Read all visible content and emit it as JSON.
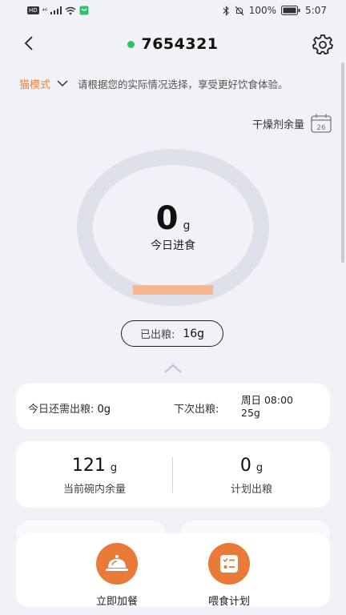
{
  "status_bar": {
    "network_badge": "HD",
    "signal_label": "⁴⁶",
    "battery_percent": "100%",
    "time": "5:07"
  },
  "header": {
    "device_id": "7654321",
    "online_color": "#2ec26a"
  },
  "mode": {
    "label": "猫模式",
    "hint": "请根据您的实际情况选择，享受更好饮食体验。"
  },
  "desiccant": {
    "label": "干燥剂余量",
    "calendar_day": "26"
  },
  "today": {
    "food_value": "0",
    "food_unit": "g",
    "food_label": "今日进食",
    "ring_fill_fraction": 0.06
  },
  "dispensed": {
    "label": "已出粮:",
    "value": "16g"
  },
  "schedule": {
    "remaining_label": "今日还需出粮:",
    "remaining_value": "0g",
    "next_label": "下次出粮:",
    "next_time": "周日 08:00",
    "next_amount": "25g"
  },
  "stats": {
    "bowl_value": "121",
    "bowl_unit": "g",
    "bowl_label": "当前碗内余量",
    "plan_value": "0",
    "plan_unit": "g",
    "plan_label": "计划出粮"
  },
  "actions": {
    "feed_now": "立即加餐",
    "feeding_plan": "喂食计划"
  },
  "colors": {
    "accent": "#ea7a38",
    "ring_track": "#dfe1ea",
    "ring_fill": "#f6b48f",
    "background": "#f1f2f7"
  }
}
